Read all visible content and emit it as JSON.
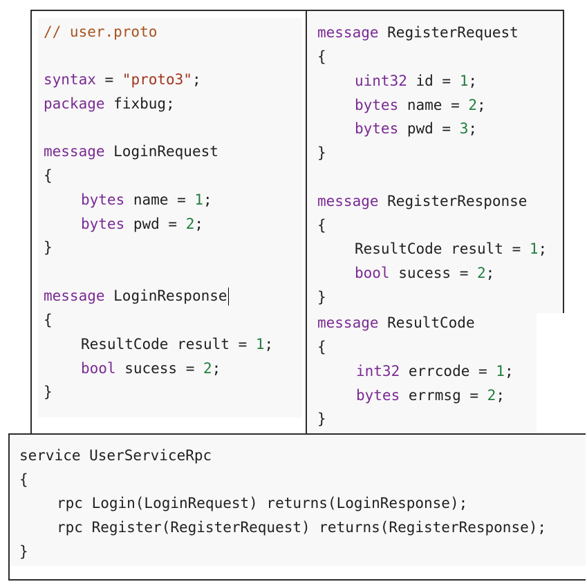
{
  "left": {
    "comment": "// user.proto",
    "syntax_kw": "syntax",
    "syntax_eq": " = ",
    "syntax_val": "\"proto3\"",
    "syntax_end": ";",
    "package_kw": "package",
    "package_name": " fixbug;",
    "msg_kw": "message",
    "login_req_name": " LoginRequest",
    "open_brace": "{",
    "close_brace": "}",
    "bytes_kw": "bytes",
    "name_field": " name = ",
    "pwd_field": " pwd = ",
    "n1": "1",
    "n2": "2",
    "semi": ";",
    "login_resp_name": " LoginResponse",
    "resultcode_field": "ResultCode result = ",
    "bool_kw": "bool",
    "sucess_field": " sucess = "
  },
  "right": {
    "msg_kw": "message",
    "register_req_name": " RegisterRequest",
    "register_resp_name": " RegisterResponse",
    "resultcode_name": " ResultCode",
    "open_brace": "{",
    "close_brace": "}",
    "uint32_kw": "uint32",
    "id_field": " id = ",
    "bytes_kw": "bytes",
    "name_field": " name = ",
    "pwd_field": " pwd = ",
    "n1": "1",
    "n2": "2",
    "n3": "3",
    "semi": ";",
    "resultcode_field": "ResultCode result = ",
    "bool_kw": "bool",
    "sucess_field": " sucess = ",
    "int32_kw": "int32",
    "errcode_field": " errcode = ",
    "errmsg_field": " errmsg = "
  },
  "bottom": {
    "service_line": "service UserServiceRpc",
    "open_brace": "{",
    "rpc_login": "rpc Login(LoginRequest) returns(LoginResponse);",
    "rpc_register": "rpc Register(RegisterRequest) returns(RegisterResponse);",
    "close_brace": "}"
  },
  "colors": {
    "keyword": "#7a2a93",
    "number": "#1e7d3c",
    "string": "#a2341e",
    "comment": "#a8521d",
    "code_bg": "#f8f8f8",
    "border": "#2b2b2b"
  }
}
